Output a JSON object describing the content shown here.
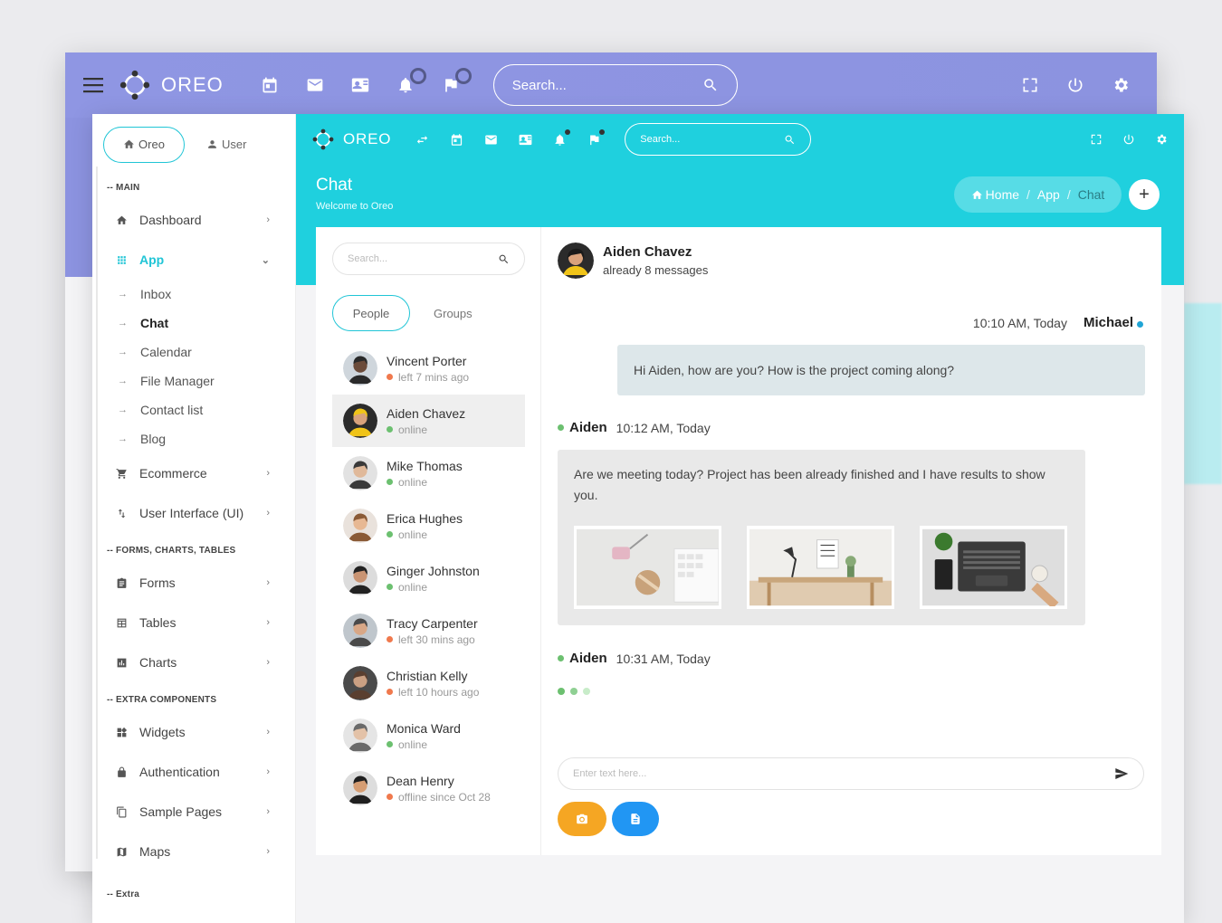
{
  "bg_window": {
    "brand": "OREO",
    "search_placeholder": "Search..."
  },
  "top": {
    "brand": "OREO",
    "search_placeholder": "Search..."
  },
  "sidebar": {
    "tabs": [
      "Oreo",
      "User"
    ],
    "sections": {
      "main": "-- MAIN",
      "forms": "-- FORMS, CHARTS, TABLES",
      "extra_components": "-- EXTRA COMPONENTS",
      "extra": "-- Extra"
    },
    "main_items": [
      {
        "label": "Dashboard"
      },
      {
        "label": "App"
      }
    ],
    "app_sub": [
      "Inbox",
      "Chat",
      "Calendar",
      "File Manager",
      "Contact list",
      "Blog"
    ],
    "main_items_after": [
      {
        "label": "Ecommerce"
      },
      {
        "label": "User Interface (UI)"
      }
    ],
    "forms_items": [
      {
        "label": "Forms"
      },
      {
        "label": "Tables"
      },
      {
        "label": "Charts"
      }
    ],
    "extra_items": [
      {
        "label": "Widgets"
      },
      {
        "label": "Authentication"
      },
      {
        "label": "Sample Pages"
      },
      {
        "label": "Maps"
      }
    ]
  },
  "hero": {
    "title": "Chat",
    "subtitle": "Welcome to Oreo",
    "breadcrumb": [
      "Home",
      "App",
      "Chat"
    ]
  },
  "people": {
    "search_placeholder": "Search...",
    "tabs": [
      "People",
      "Groups"
    ],
    "list": [
      {
        "name": "Vincent Porter",
        "status": "left 7 mins ago",
        "dot": "#f0794d"
      },
      {
        "name": "Aiden Chavez",
        "status": "online",
        "dot": "#6cc070"
      },
      {
        "name": "Mike Thomas",
        "status": "online",
        "dot": "#6cc070"
      },
      {
        "name": "Erica Hughes",
        "status": "online",
        "dot": "#6cc070"
      },
      {
        "name": "Ginger Johnston",
        "status": "online",
        "dot": "#6cc070"
      },
      {
        "name": "Tracy Carpenter",
        "status": "left 30 mins ago",
        "dot": "#f0794d"
      },
      {
        "name": "Christian Kelly",
        "status": "left 10 hours ago",
        "dot": "#f0794d"
      },
      {
        "name": "Monica Ward",
        "status": "online",
        "dot": "#6cc070"
      },
      {
        "name": "Dean Henry",
        "status": "offline since Oct 28",
        "dot": "#f0794d"
      }
    ]
  },
  "conversation": {
    "name": "Aiden Chavez",
    "subtitle": "already 8 messages",
    "messages": [
      {
        "time": "10:10 AM, Today",
        "author": "Michael",
        "text": "Hi Aiden, how are you? How is the project coming along?"
      },
      {
        "author": "Aiden",
        "time": "10:12 AM, Today",
        "text": "Are we meeting today? Project has been already finished and I have results to show you."
      },
      {
        "author": "Aiden",
        "time": "10:31 AM, Today"
      }
    ],
    "input_placeholder": "Enter text here..."
  },
  "colors": {
    "accent": "#1fd0de",
    "bg_header": "#8f96e3",
    "online": "#6cc070",
    "away": "#f0794d",
    "camera_button": "#f5a623",
    "doc_button": "#2196f3"
  }
}
